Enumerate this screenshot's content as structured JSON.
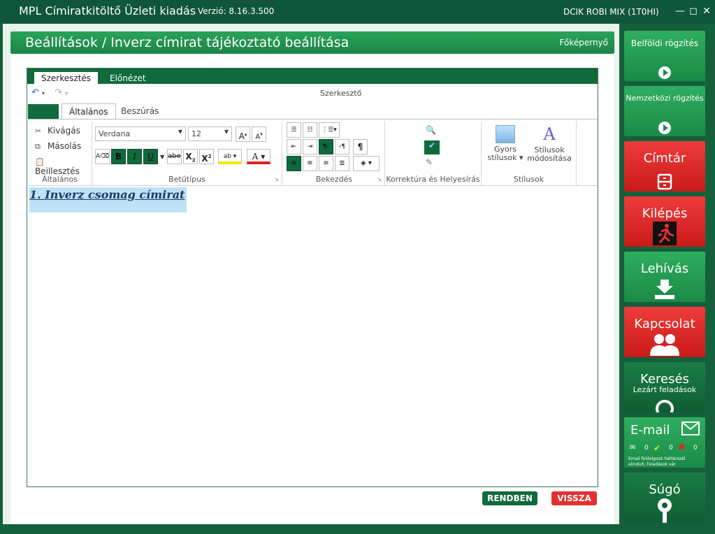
{
  "window": {
    "app_title": "MPL Címiratkitöltő Üzleti kiadás",
    "version": "Verzió: 8.16.3.500",
    "company": "DCIK ROBI MIX (1T0HI)",
    "minimize": "—",
    "maximize": "◻",
    "close": "✕"
  },
  "header": {
    "title": "Beállítások / Inverz címirat tájékoztató beállítása",
    "home_link": "Főképernyő"
  },
  "editor": {
    "tabs": [
      "Szerkesztés",
      "Előnézet"
    ],
    "caption": "Szerkesztő",
    "ribbon_tabs": [
      "Általános",
      "Beszúrás"
    ],
    "groups": {
      "general": {
        "label": "Általános",
        "cut": "Kivágás",
        "copy": "Másolás",
        "paste": "Beillesztés"
      },
      "font": {
        "label": "Betűtípus",
        "font_name": "Verdana",
        "font_size": "12"
      },
      "paragraph": {
        "label": "Bekezdés"
      },
      "proofing": {
        "label": "Korrektúra és Helyesírás"
      },
      "styles": {
        "label": "Stílusok",
        "quick_styles_1": "Gyors",
        "quick_styles_2": "stílusok",
        "modify_styles_1": "Stílusok",
        "modify_styles_2": "módosítása"
      }
    },
    "document_text": "1. Inverz csomag címirat"
  },
  "buttons": {
    "ok": "RENDBEN",
    "back": "VISSZA"
  },
  "sidebar": {
    "domestic": "Belföldi rögzítés",
    "international": "Nemzetközi rögzítés",
    "directory": "Címtár",
    "exit": "Kilépés",
    "call": "Lehívás",
    "contact": "Kapcsolat",
    "search": "Keresés",
    "search_sub": "Lezárt feladások",
    "email": "E-mail",
    "email_counts": [
      "0",
      "0",
      "0"
    ],
    "email_note": "Email feldolgozó háttérszál elindult. Feladások vár",
    "help": "Súgó"
  },
  "colors": {
    "brand_green": "#1c8445",
    "dark_green": "#0f6a3c",
    "accent_red": "#e53030"
  }
}
